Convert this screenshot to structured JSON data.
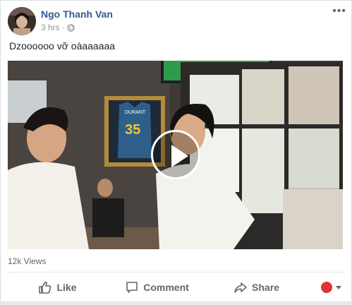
{
  "post": {
    "author_name": "Ngo Thanh Van",
    "time_text": "3 hrs",
    "separator": "·",
    "text": "Dzoooooo vỡ oàaaaaaa",
    "video": {
      "jersey_number": "35",
      "jersey_name": "DURANT"
    },
    "views": "12k Views",
    "actions": {
      "like_label": "Like",
      "comment_label": "Comment",
      "share_label": "Share"
    },
    "more_label": "•••"
  },
  "colors": {
    "name_blue": "#365899",
    "meta_gray": "#90949c",
    "action_gray": "#606770",
    "tv_green": "#2f9b4a"
  }
}
